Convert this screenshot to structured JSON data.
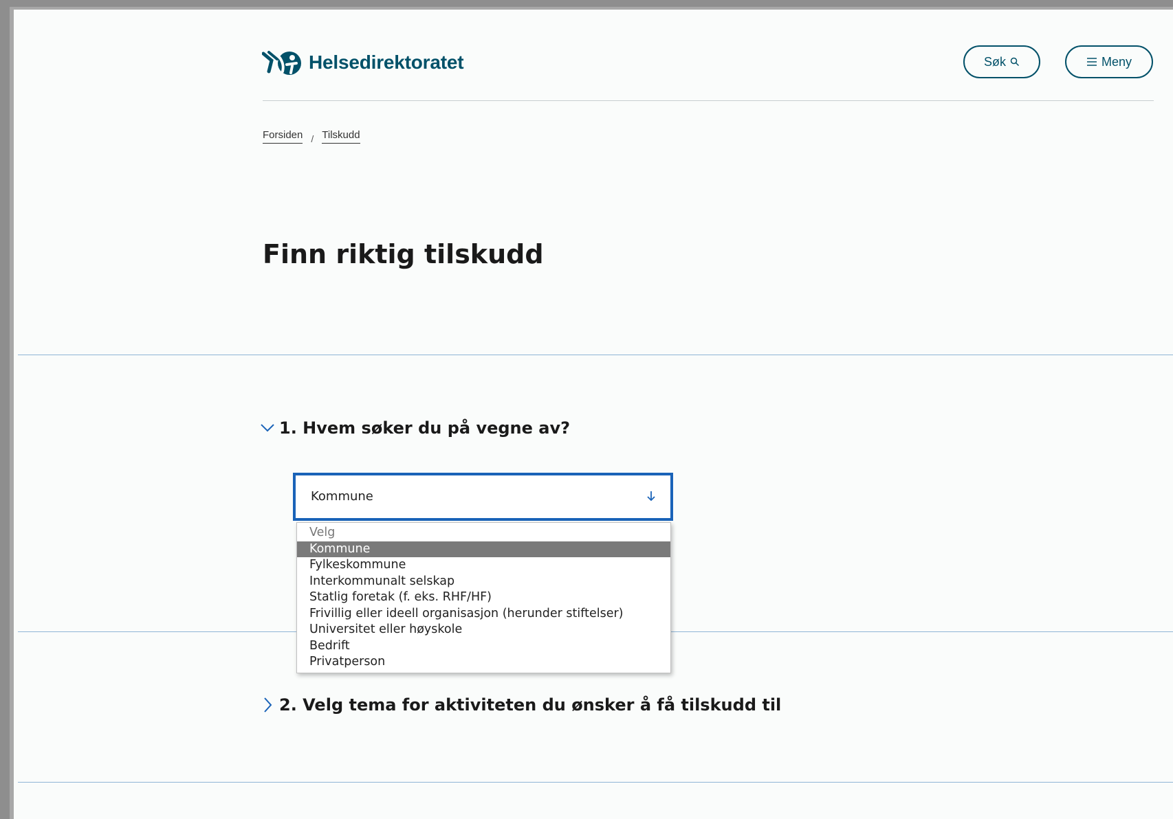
{
  "header": {
    "logo_text": "Helsedirektoratet",
    "search_label": "Søk",
    "menu_label": "Meny"
  },
  "breadcrumb": {
    "items": [
      "Forsiden",
      "Tilskudd"
    ],
    "separator": "/"
  },
  "page_title": "Finn riktig tilskudd",
  "sections": [
    {
      "title": "1. Hvem søker du på vegne av?",
      "expanded": true,
      "select": {
        "value": "Kommune",
        "options": [
          "Velg",
          "Kommune",
          "Fylkeskommune",
          "Interkommunalt selskap",
          "Statlig foretak (f. eks. RHF/HF)",
          "Frivillig eller ideell organisasjon (herunder stiftelser)",
          "Universitet eller høyskole",
          "Bedrift",
          "Privatperson"
        ],
        "selected_index": 1
      }
    },
    {
      "title": "2. Velg tema for aktiviteten du ønsker å få tilskudd til",
      "expanded": false
    }
  ],
  "colors": {
    "brand": "#025169",
    "focus": "#1a63b8",
    "divider": "#8fb5d6",
    "option_highlight": "#7a7a7a"
  },
  "icons": {
    "logo": "helsedirektoratet-logo-icon",
    "search": "search-icon",
    "menu": "hamburger-icon",
    "select_arrow": "arrow-down-icon",
    "expanded": "chevron-down-icon",
    "collapsed": "chevron-right-icon"
  }
}
